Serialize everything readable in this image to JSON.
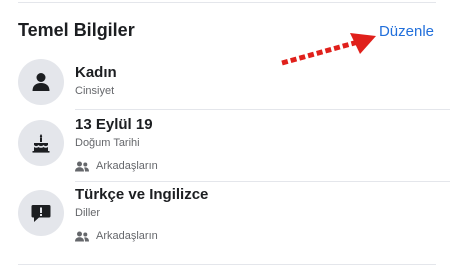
{
  "header": {
    "title": "Temel Bilgiler",
    "edit_label": "Düzenle"
  },
  "items": [
    {
      "icon": "person-icon",
      "value": "Kadın",
      "label": "Cinsiyet"
    },
    {
      "icon": "birthday-cake-icon",
      "value": "13 Eylül 19",
      "label": "Doğum Tarihi",
      "privacy": "Arkadaşların"
    },
    {
      "icon": "speech-bubble-exclamation-icon",
      "value": "Türkçe ve Ingilizce",
      "label": "Diller",
      "privacy": "Arkadaşların"
    }
  ],
  "colors": {
    "accent": "#216fdb",
    "arrow": "#e0201b",
    "icon_bg": "#e4e6eb"
  }
}
